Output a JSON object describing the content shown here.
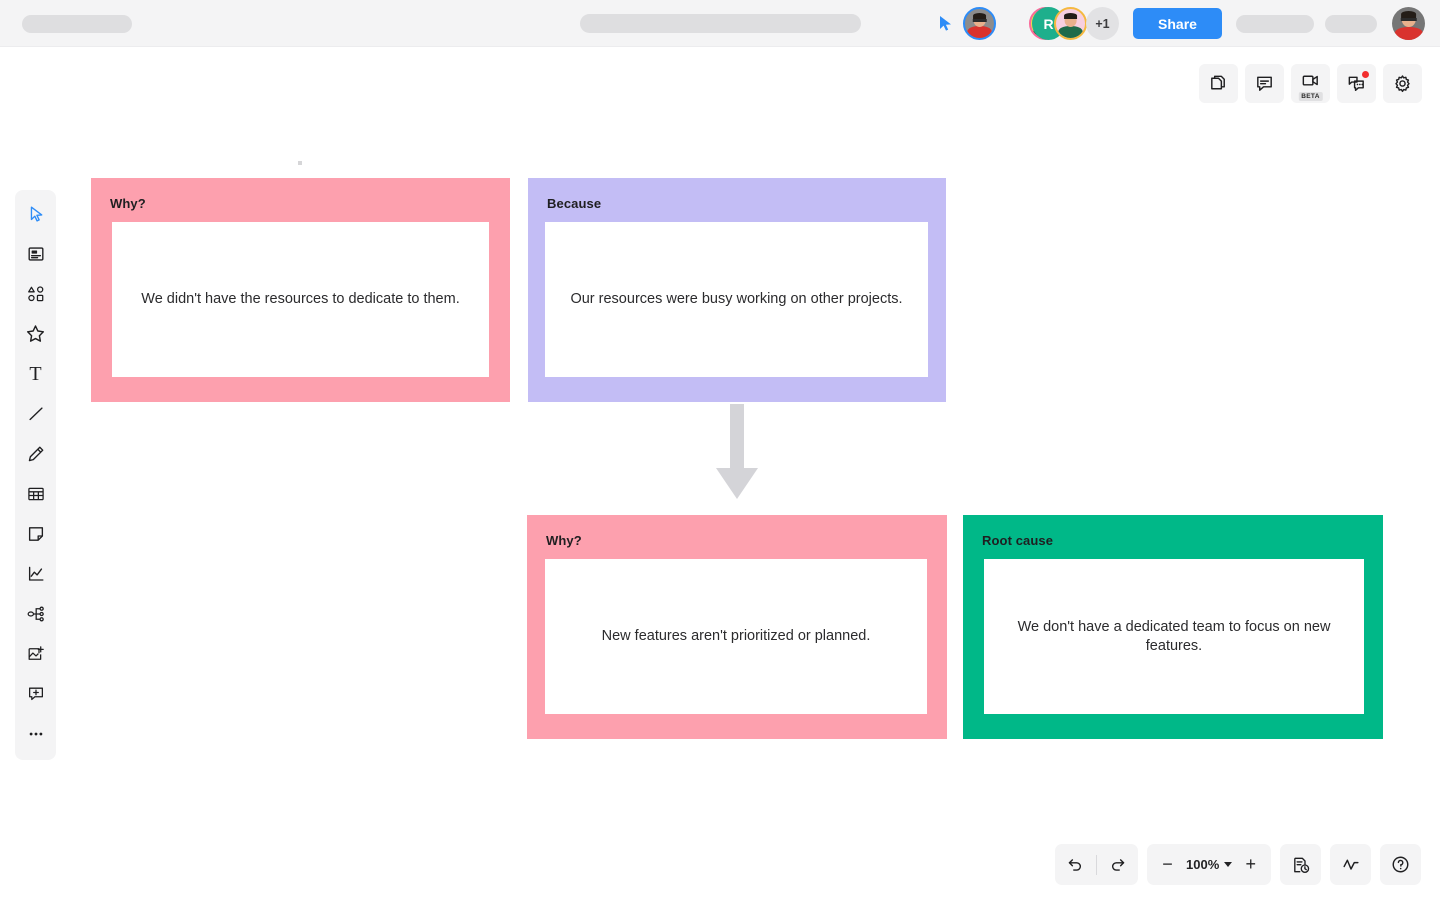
{
  "app": {
    "background": "#ffffff",
    "accent": "#2d8cf7"
  },
  "topbar": {
    "share_label": "Share",
    "collaborators": [
      {
        "name": "avatar-person-1",
        "initial": "",
        "ring": "#2d8cf7"
      },
      {
        "name": "avatar-person-2",
        "initial": "",
        "ring": "#f96a9a"
      },
      {
        "name": "avatar-initial-r",
        "initial": "R",
        "ring": "#1eaf8c"
      },
      {
        "name": "avatar-person-3",
        "initial": "",
        "ring": "#f5b93f"
      }
    ],
    "overflow_count": "+1",
    "cursor_icon": "pointer-cursor-icon",
    "logo_placeholder": "",
    "title_placeholder": "",
    "action_placeholder_1": "",
    "action_placeholder_2": "",
    "me_avatar": "current-user-avatar"
  },
  "top_right_tools": [
    {
      "name": "pages-icon",
      "label": "",
      "badge": ""
    },
    {
      "name": "comment-icon",
      "label": "",
      "badge": ""
    },
    {
      "name": "video-camera-icon",
      "label": "BETA",
      "badge": ""
    },
    {
      "name": "chat-icon",
      "label": "",
      "badge": "notification"
    },
    {
      "name": "gear-icon",
      "label": "",
      "badge": ""
    }
  ],
  "left_toolbar": [
    {
      "name": "select-cursor-tool",
      "label": "Select"
    },
    {
      "name": "template-tool",
      "label": "Templates"
    },
    {
      "name": "shapes-tool",
      "label": "Shapes"
    },
    {
      "name": "star-tool",
      "label": "Star"
    },
    {
      "name": "text-tool",
      "label": "Text"
    },
    {
      "name": "line-tool",
      "label": "Line"
    },
    {
      "name": "pen-tool",
      "label": "Pen"
    },
    {
      "name": "table-tool",
      "label": "Table"
    },
    {
      "name": "sticky-note-tool",
      "label": "Sticky note"
    },
    {
      "name": "chart-tool",
      "label": "Chart"
    },
    {
      "name": "mindmap-tool",
      "label": "Mind map"
    },
    {
      "name": "image-upload-tool",
      "label": "Upload image"
    },
    {
      "name": "add-comment-tool",
      "label": "Comment"
    },
    {
      "name": "more-tools",
      "label": "More"
    }
  ],
  "canvas": {
    "cards": [
      {
        "id": "card-why-1",
        "label": "Why?",
        "text": "We didn't have the resources to dedicate to them.",
        "color": "#fda0ae"
      },
      {
        "id": "card-because",
        "label": "Because",
        "text": "Our resources were busy working on other projects.",
        "color": "#c3bdf5"
      },
      {
        "id": "card-why-2",
        "label": "Why?",
        "text": "New features aren't prioritized or planned.",
        "color": "#fda0ae"
      },
      {
        "id": "card-root",
        "label": "Root cause",
        "text": "We don't have a dedicated team to focus on new features.",
        "color": "#00b888"
      }
    ],
    "connector": {
      "name": "down-arrow-connector",
      "color": "#d4d4d8"
    }
  },
  "bottombar": {
    "undo": "undo-icon",
    "redo": "redo-icon",
    "zoom_out": "−",
    "zoom_level": "100%",
    "zoom_in": "+",
    "history": "version-history-icon",
    "activity": "activity-pulse-icon",
    "help": "help-icon"
  }
}
